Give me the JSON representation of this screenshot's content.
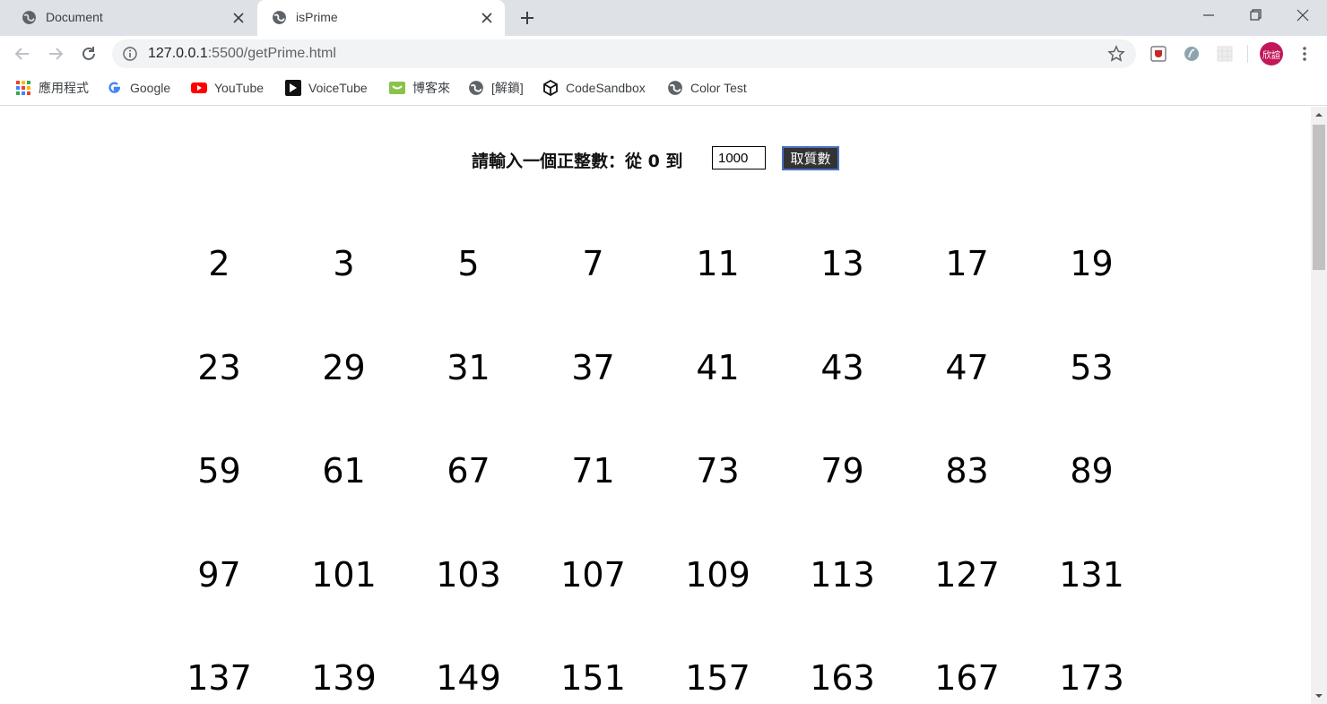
{
  "browser": {
    "tabs": [
      {
        "title": "Document",
        "active": false
      },
      {
        "title": "isPrime",
        "active": true
      }
    ],
    "url_host": "127.0.0.1",
    "url_rest": ":5500/getPrime.html",
    "avatar_label": "欣諠"
  },
  "bookmarks": [
    {
      "label": "應用程式",
      "icon": "apps-grid-icon"
    },
    {
      "label": "Google",
      "icon": "google-icon"
    },
    {
      "label": "YouTube",
      "icon": "youtube-icon"
    },
    {
      "label": "VoiceTube",
      "icon": "voicetube-icon"
    },
    {
      "label": "博客來",
      "icon": "books-icon"
    },
    {
      "label": "[解鎖]",
      "icon": "globe-icon"
    },
    {
      "label": "CodeSandbox",
      "icon": "codesandbox-icon"
    },
    {
      "label": "Color Test",
      "icon": "globe-icon"
    }
  ],
  "form": {
    "label": "請輸入一個正整數：從 0 到",
    "input_value": "1000",
    "button_label": "取質數"
  },
  "primes": [
    "2",
    "3",
    "5",
    "7",
    "11",
    "13",
    "17",
    "19",
    "23",
    "29",
    "31",
    "37",
    "41",
    "43",
    "47",
    "53",
    "59",
    "61",
    "67",
    "71",
    "73",
    "79",
    "83",
    "89",
    "97",
    "101",
    "103",
    "107",
    "109",
    "113",
    "127",
    "131",
    "137",
    "139",
    "149",
    "151",
    "157",
    "163",
    "167",
    "173"
  ],
  "colors": {
    "tabstrip": "#dee1e6",
    "button_bg": "#333333",
    "button_border": "#4a6fc1",
    "avatar": "#c2185b"
  }
}
